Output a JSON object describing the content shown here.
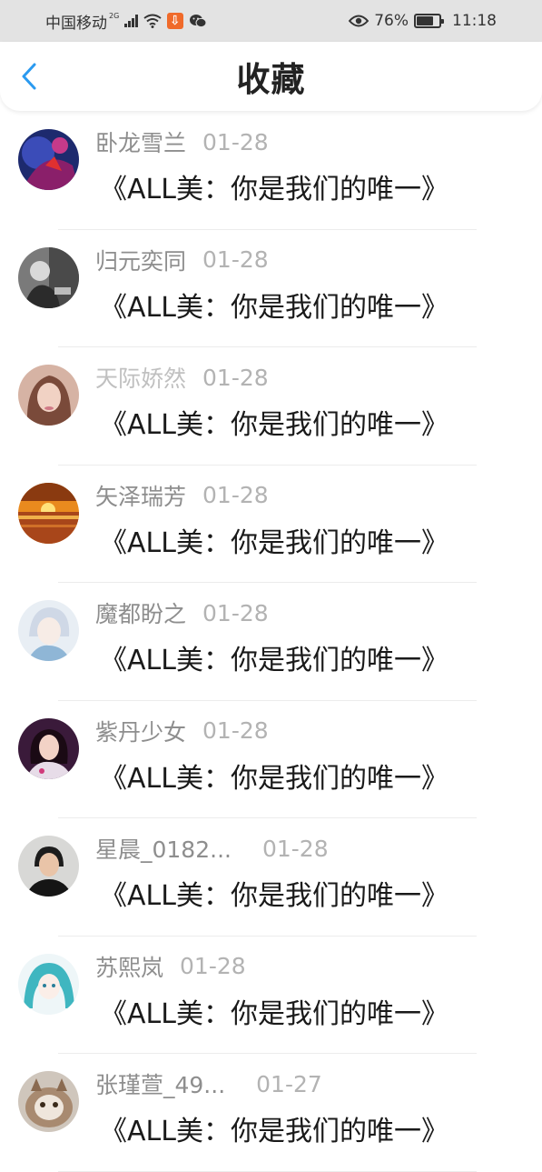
{
  "status_bar": {
    "carrier": "中国移动",
    "network_gen": "2G",
    "battery_percent": "76%",
    "battery_level": 0.76,
    "time": "11:18",
    "icons": [
      "signal-icon",
      "wifi-icon",
      "download-icon",
      "wechat-icon",
      "eye-icon",
      "battery-icon"
    ]
  },
  "nav": {
    "back_icon": "chevron-left-icon",
    "title": "收藏",
    "accent_color": "#2a9af0"
  },
  "favorites": [
    {
      "name": "卧龙雪兰",
      "date": "01-28",
      "title": "《ALL美：你是我们的唯一》"
    },
    {
      "name": "归元奕同",
      "date": "01-28",
      "title": "《ALL美：你是我们的唯一》"
    },
    {
      "name": "天际娇然",
      "date": "01-28",
      "title": "《ALL美：你是我们的唯一》"
    },
    {
      "name": "矢泽瑞芳",
      "date": "01-28",
      "title": "《ALL美：你是我们的唯一》"
    },
    {
      "name": "魔都盼之",
      "date": "01-28",
      "title": "《ALL美：你是我们的唯一》"
    },
    {
      "name": "紫丹少女",
      "date": "01-28",
      "title": "《ALL美：你是我们的唯一》"
    },
    {
      "name": "星晨_0182...",
      "date": "01-28",
      "title": "《ALL美：你是我们的唯一》"
    },
    {
      "name": "苏熙岚",
      "date": "01-28",
      "title": "《ALL美：你是我们的唯一》"
    },
    {
      "name": "张瑾萱_49...",
      "date": "01-27",
      "title": "《ALL美：你是我们的唯一》"
    }
  ]
}
